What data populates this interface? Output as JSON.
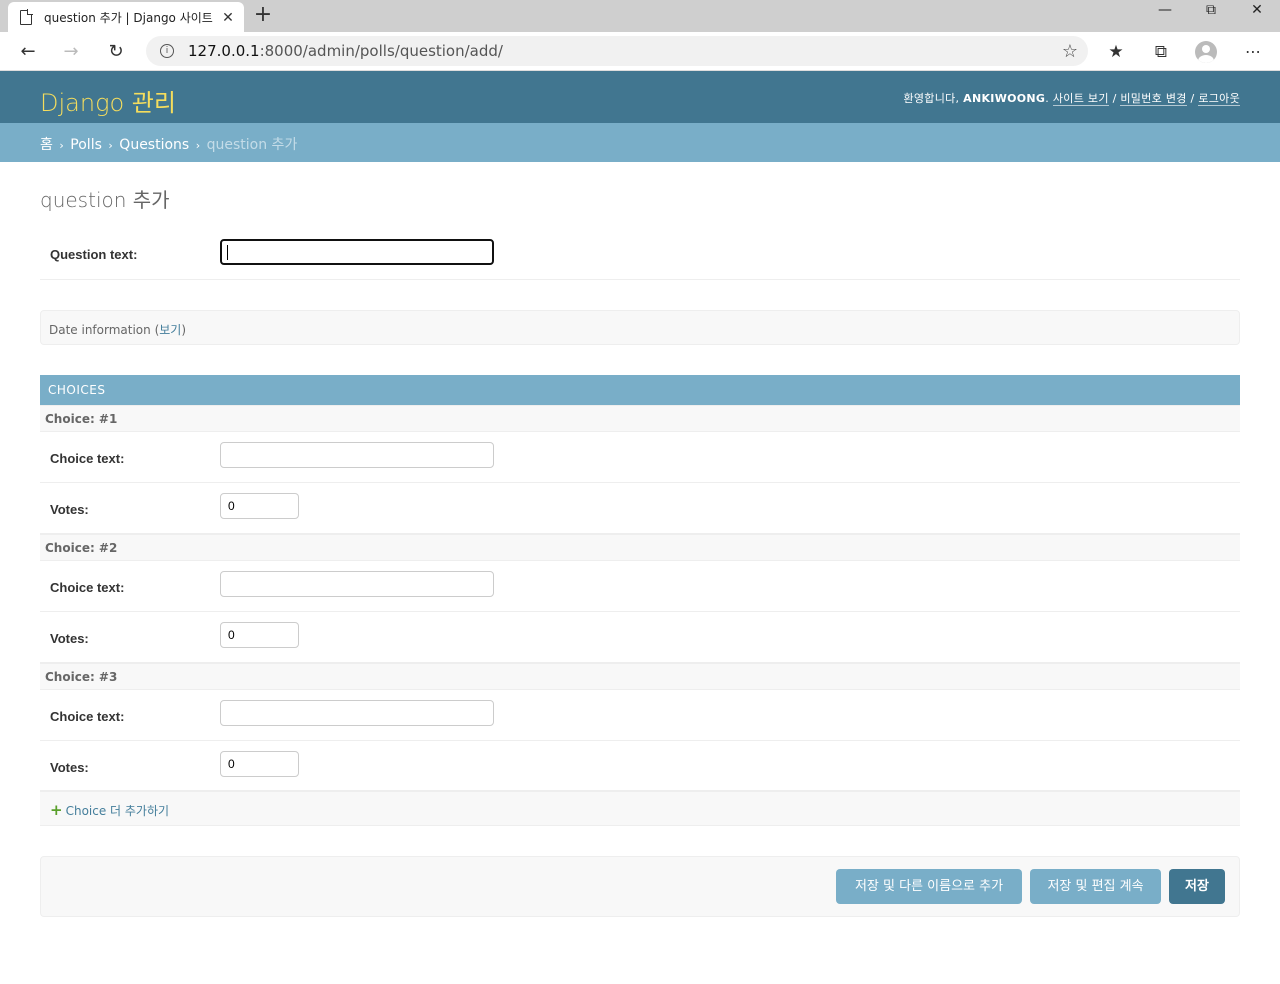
{
  "browser": {
    "tab_title": "question 추가 | Django 사이트 관리",
    "tab_close": "✕",
    "new_tab": "+",
    "url_host": "127.0.0.1",
    "url_rest": ":8000/admin/polls/question/add/"
  },
  "header": {
    "branding": "Django 관리",
    "welcome": "환영합니다,",
    "username": "ANKIWOONG",
    "view_site": "사이트 보기",
    "change_password": "비밀번호 변경",
    "logout": "로그아웃",
    "separator": "/"
  },
  "breadcrumbs": {
    "home": "홈",
    "app": "Polls",
    "model": "Questions",
    "current": "question 추가"
  },
  "page": {
    "title": "question 추가"
  },
  "form": {
    "question_text_label": "Question text:",
    "question_text_value": "",
    "date_info_label": "Date information",
    "date_info_toggle": "보기"
  },
  "inline": {
    "header": "CHOICES",
    "choice_text_label": "Choice text:",
    "votes_label": "Votes:",
    "choices": [
      {
        "title": "Choice: #1",
        "choice_text": "",
        "votes": "0"
      },
      {
        "title": "Choice: #2",
        "choice_text": "",
        "votes": "0"
      },
      {
        "title": "Choice: #3",
        "choice_text": "",
        "votes": "0"
      }
    ],
    "add_another": "Choice 더 추가하기"
  },
  "submit": {
    "save_add_another": "저장 및 다른 이름으로 추가",
    "save_continue": "저장 및 편집 계속",
    "save": "저장"
  },
  "colors": {
    "header_bg": "#417690",
    "breadcrumb_bg": "#79aec8",
    "branding": "#f5dd5d",
    "link": "#447e9b"
  }
}
